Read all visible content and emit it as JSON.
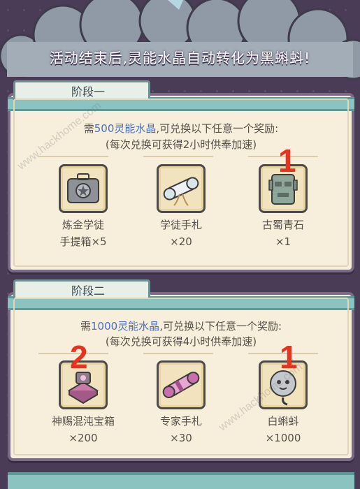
{
  "banner": "活动结束后,灵能水晶自动转化为黑蝌蚪!",
  "stages": [
    {
      "title": "阶段一",
      "desc_pre": "需",
      "desc_amount": "500灵能水晶",
      "desc_post": ",可兑换以下任意一个奖励:",
      "desc_note": "(每次兑换可获得2小时供奉加速)",
      "items": [
        {
          "name": "炼金学徒",
          "name2": "手提箱×5",
          "qty": "",
          "icon": "suitcase-icon"
        },
        {
          "name": "学徒手札",
          "name2": "",
          "qty": "×20",
          "icon": "scroll-icon"
        },
        {
          "name": "古蜀青石",
          "name2": "",
          "qty": "×1",
          "icon": "mask-stone-icon"
        }
      ],
      "annotations": [
        "",
        "",
        "1"
      ]
    },
    {
      "title": "阶段二",
      "desc_pre": "需",
      "desc_amount": "1000灵能水晶",
      "desc_post": ",可兑换以下任意一个奖励:",
      "desc_note": "(每次兑换可获得4小时供奉加速)",
      "items": [
        {
          "name": "神赐混沌宝箱",
          "name2": "",
          "qty": "×200",
          "icon": "chaos-chest-icon"
        },
        {
          "name": "专家手札",
          "name2": "",
          "qty": "×30",
          "icon": "expert-scroll-icon"
        },
        {
          "name": "白蝌蚪",
          "name2": "",
          "qty": "×1000",
          "icon": "white-tadpole-icon"
        }
      ],
      "annotations": [
        "2",
        "",
        "1"
      ]
    }
  ],
  "watermark": "www.hackhome.com"
}
